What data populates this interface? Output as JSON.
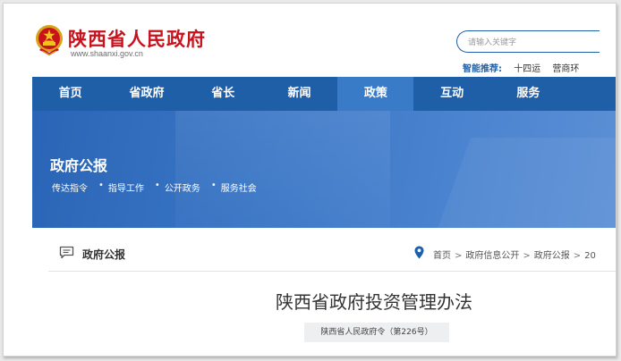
{
  "header": {
    "site_title": "陕西省人民政府",
    "site_url": "www.shaanxi.gov.cn",
    "search_placeholder": "请输入关键字",
    "smart_label": "智能推荐:",
    "smart_tags": [
      "十四运",
      "营商环"
    ]
  },
  "nav": {
    "items": [
      {
        "label": "首页",
        "active": false
      },
      {
        "label": "省政府",
        "active": false
      },
      {
        "label": "省长",
        "active": false
      },
      {
        "label": "新闻",
        "active": false
      },
      {
        "label": "政策",
        "active": true
      },
      {
        "label": "互动",
        "active": false
      },
      {
        "label": "服务",
        "active": false
      }
    ]
  },
  "banner": {
    "title": "政府公报",
    "links": [
      "传达指令",
      "指导工作",
      "公开政务",
      "服务社会"
    ]
  },
  "breadcrumb_bar": {
    "section_title": "政府公报",
    "crumbs": [
      "首页",
      "政府信息公开",
      "政府公报",
      "20"
    ]
  },
  "article": {
    "title": "陕西省政府投资管理办法",
    "decree": "陕西省人民政府令（第226号）"
  },
  "colors": {
    "brand_red": "#c8121c",
    "nav_blue": "#1f5fa8",
    "nav_active": "#3a7bc8"
  }
}
